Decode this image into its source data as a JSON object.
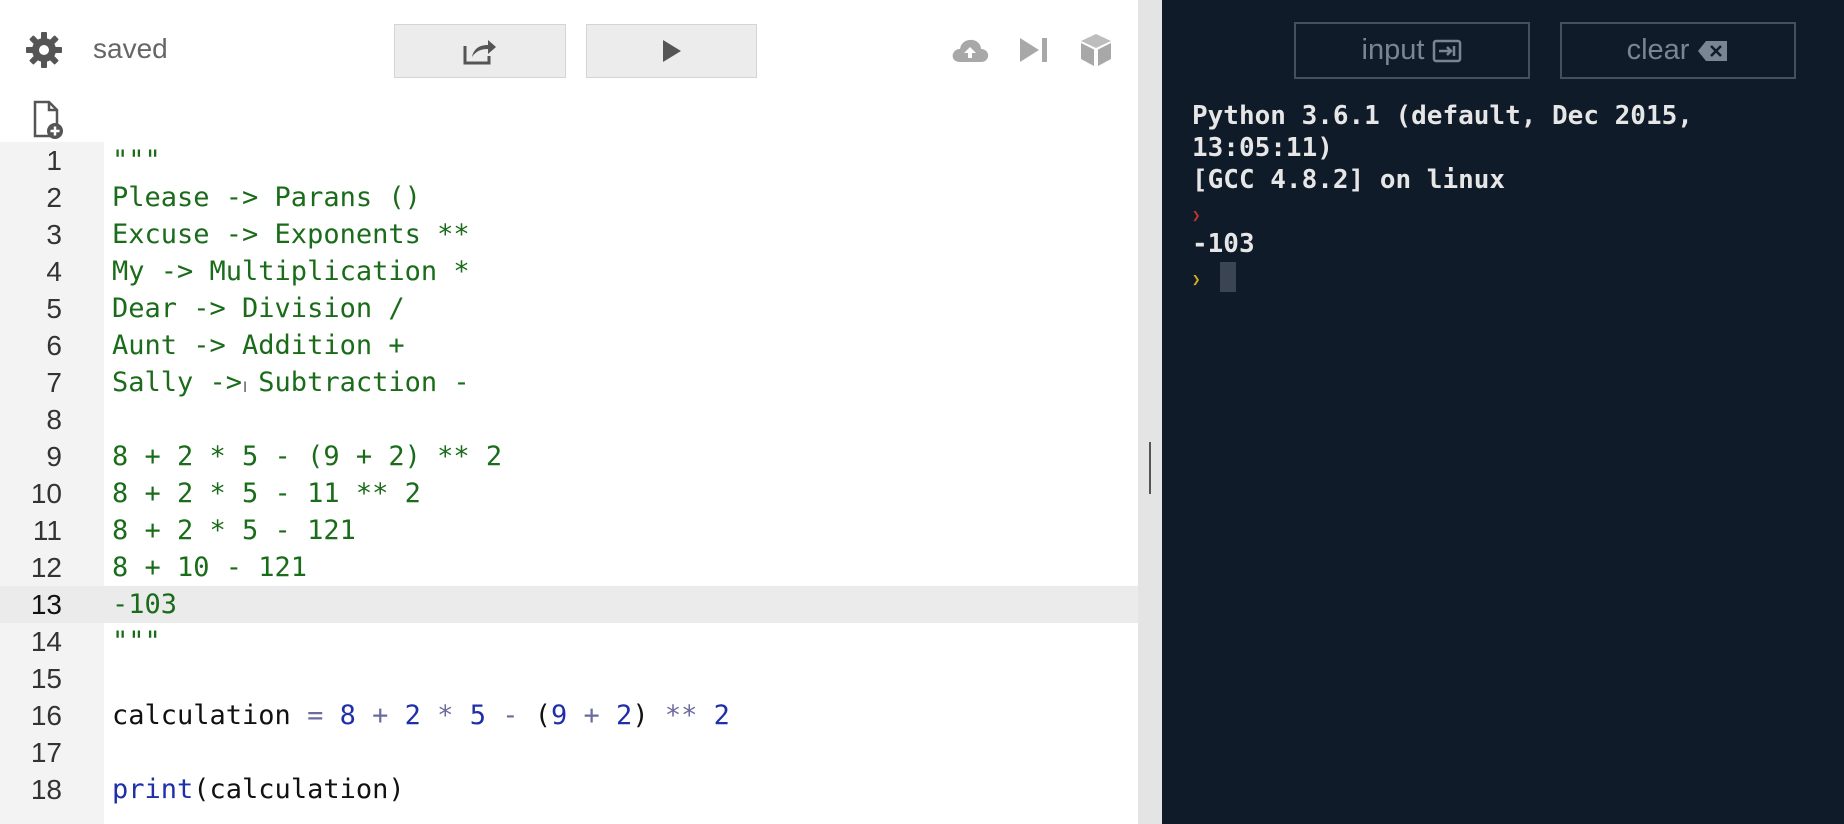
{
  "toolbar": {
    "status": "saved",
    "icons": {
      "settings": "gear-icon",
      "share": "share-icon",
      "run": "play-icon",
      "upload": "cloud-upload-icon",
      "step": "step-forward-icon",
      "package": "cube-icon",
      "new_file": "new-file-icon"
    }
  },
  "editor": {
    "active_line": 13,
    "lines": [
      {
        "n": "1",
        "text": "\"\"\""
      },
      {
        "n": "2",
        "text": "Please -> Parans ()"
      },
      {
        "n": "3",
        "text": "Excuse -> Exponents **"
      },
      {
        "n": "4",
        "text": "My -> Multiplication *"
      },
      {
        "n": "5",
        "text": "Dear -> Division /"
      },
      {
        "n": "6",
        "text": "Aunt -> Addition +"
      },
      {
        "n": "7",
        "text": "Sally -> Subtraction -"
      },
      {
        "n": "8",
        "text": ""
      },
      {
        "n": "9",
        "text": "8 + 2 * 5 - (9 + 2) ** 2"
      },
      {
        "n": "10",
        "text": "8 + 2 * 5 - 11 ** 2"
      },
      {
        "n": "11",
        "text": "8 + 2 * 5 - 121"
      },
      {
        "n": "12",
        "text": "8 + 10 - 121"
      },
      {
        "n": "13",
        "text": "-103"
      },
      {
        "n": "14",
        "text": "\"\"\""
      },
      {
        "n": "15",
        "text": ""
      },
      {
        "n": "16",
        "tokens": [
          "calculation",
          " = ",
          "8",
          " + ",
          "2",
          " * ",
          "5",
          " - ",
          "(",
          "9",
          " + ",
          "2",
          ")",
          " ** ",
          "2"
        ]
      },
      {
        "n": "17",
        "text": ""
      },
      {
        "n": "18",
        "tokens": [
          "print",
          "(calculation)"
        ]
      }
    ]
  },
  "console": {
    "input_label": "input",
    "clear_label": "clear",
    "input_icon": "enter-icon",
    "clear_icon": "backspace-icon",
    "banner_1": "Python 3.6.1 (default, Dec 2015,",
    "banner_2": "13:05:11)",
    "banner_3": "[GCC 4.8.2] on linux",
    "output": "-103"
  },
  "colors": {
    "console_bg": "#0f1b29",
    "string": "#1a6b1a",
    "number": "#1f2fa8",
    "prompt_red": "#c0392b",
    "prompt_yellow": "#d4b21e"
  }
}
